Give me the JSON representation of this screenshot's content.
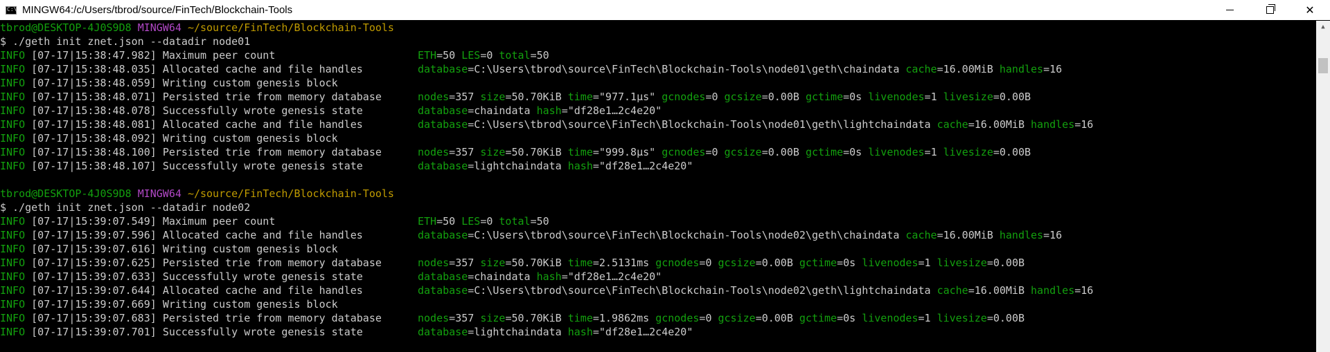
{
  "window": {
    "icon_text": "C:\\",
    "title": "MINGW64:/c/Users/tbrod/source/FinTech/Blockchain-Tools",
    "minimize_label": "",
    "maximize_label": "",
    "close_label": "✕"
  },
  "scrollbar": {
    "up_arrow": "▲"
  },
  "prompt": {
    "user_host": "tbrod@DESKTOP-4J0S9D8",
    "env": "MINGW64",
    "path": "~/source/FinTech/Blockchain-Tools"
  },
  "lines": [
    {
      "type": "prompt"
    },
    {
      "type": "cmd",
      "text": "$ ./geth init znet.json --datadir node01"
    },
    {
      "type": "log",
      "level": "INFO",
      "ts": "[07-17|15:38:47.982]",
      "msg": "Maximum peer count",
      "fields": [
        [
          "ETH",
          "50"
        ],
        [
          "LES",
          "0"
        ],
        [
          "total",
          "50"
        ]
      ]
    },
    {
      "type": "log",
      "level": "INFO",
      "ts": "[07-17|15:38:48.035]",
      "msg": "Allocated cache and file handles",
      "fields": [
        [
          "database",
          "C:\\Users\\tbrod\\source\\FinTech\\Blockchain-Tools\\node01\\geth\\chaindata"
        ],
        [
          "cache",
          "16.00MiB"
        ],
        [
          "handles",
          "16"
        ]
      ]
    },
    {
      "type": "log",
      "level": "INFO",
      "ts": "[07-17|15:38:48.059]",
      "msg": "Writing custom genesis block",
      "fields": []
    },
    {
      "type": "log",
      "level": "INFO",
      "ts": "[07-17|15:38:48.071]",
      "msg": "Persisted trie from memory database",
      "fields": [
        [
          "nodes",
          "357"
        ],
        [
          "size",
          "50.70KiB"
        ],
        [
          "time",
          "\"977.1µs\""
        ],
        [
          "gcnodes",
          "0"
        ],
        [
          "gcsize",
          "0.00B"
        ],
        [
          "gctime",
          "0s"
        ],
        [
          "livenodes",
          "1"
        ],
        [
          "livesize",
          "0.00B"
        ]
      ]
    },
    {
      "type": "log",
      "level": "INFO",
      "ts": "[07-17|15:38:48.078]",
      "msg": "Successfully wrote genesis state",
      "fields": [
        [
          "database",
          "chaindata"
        ],
        [
          "hash",
          "\"df28e1…2c4e20\""
        ]
      ]
    },
    {
      "type": "log",
      "level": "INFO",
      "ts": "[07-17|15:38:48.081]",
      "msg": "Allocated cache and file handles",
      "fields": [
        [
          "database",
          "C:\\Users\\tbrod\\source\\FinTech\\Blockchain-Tools\\node01\\geth\\lightchaindata"
        ],
        [
          "cache",
          "16.00MiB"
        ],
        [
          "handles",
          "16"
        ]
      ]
    },
    {
      "type": "log",
      "level": "INFO",
      "ts": "[07-17|15:38:48.092]",
      "msg": "Writing custom genesis block",
      "fields": []
    },
    {
      "type": "log",
      "level": "INFO",
      "ts": "[07-17|15:38:48.100]",
      "msg": "Persisted trie from memory database",
      "fields": [
        [
          "nodes",
          "357"
        ],
        [
          "size",
          "50.70KiB"
        ],
        [
          "time",
          "\"999.8µs\""
        ],
        [
          "gcnodes",
          "0"
        ],
        [
          "gcsize",
          "0.00B"
        ],
        [
          "gctime",
          "0s"
        ],
        [
          "livenodes",
          "1"
        ],
        [
          "livesize",
          "0.00B"
        ]
      ]
    },
    {
      "type": "log",
      "level": "INFO",
      "ts": "[07-17|15:38:48.107]",
      "msg": "Successfully wrote genesis state",
      "fields": [
        [
          "database",
          "lightchaindata"
        ],
        [
          "hash",
          "\"df28e1…2c4e20\""
        ]
      ]
    },
    {
      "type": "blank"
    },
    {
      "type": "prompt"
    },
    {
      "type": "cmd",
      "text": "$ ./geth init znet.json --datadir node02"
    },
    {
      "type": "log",
      "level": "INFO",
      "ts": "[07-17|15:39:07.549]",
      "msg": "Maximum peer count",
      "fields": [
        [
          "ETH",
          "50"
        ],
        [
          "LES",
          "0"
        ],
        [
          "total",
          "50"
        ]
      ]
    },
    {
      "type": "log",
      "level": "INFO",
      "ts": "[07-17|15:39:07.596]",
      "msg": "Allocated cache and file handles",
      "fields": [
        [
          "database",
          "C:\\Users\\tbrod\\source\\FinTech\\Blockchain-Tools\\node02\\geth\\chaindata"
        ],
        [
          "cache",
          "16.00MiB"
        ],
        [
          "handles",
          "16"
        ]
      ]
    },
    {
      "type": "log",
      "level": "INFO",
      "ts": "[07-17|15:39:07.616]",
      "msg": "Writing custom genesis block",
      "fields": []
    },
    {
      "type": "log",
      "level": "INFO",
      "ts": "[07-17|15:39:07.625]",
      "msg": "Persisted trie from memory database",
      "fields": [
        [
          "nodes",
          "357"
        ],
        [
          "size",
          "50.70KiB"
        ],
        [
          "time",
          "2.5131ms"
        ],
        [
          "gcnodes",
          "0"
        ],
        [
          "gcsize",
          "0.00B"
        ],
        [
          "gctime",
          "0s"
        ],
        [
          "livenodes",
          "1"
        ],
        [
          "livesize",
          "0.00B"
        ]
      ]
    },
    {
      "type": "log",
      "level": "INFO",
      "ts": "[07-17|15:39:07.633]",
      "msg": "Successfully wrote genesis state",
      "fields": [
        [
          "database",
          "chaindata"
        ],
        [
          "hash",
          "\"df28e1…2c4e20\""
        ]
      ]
    },
    {
      "type": "log",
      "level": "INFO",
      "ts": "[07-17|15:39:07.644]",
      "msg": "Allocated cache and file handles",
      "fields": [
        [
          "database",
          "C:\\Users\\tbrod\\source\\FinTech\\Blockchain-Tools\\node02\\geth\\lightchaindata"
        ],
        [
          "cache",
          "16.00MiB"
        ],
        [
          "handles",
          "16"
        ]
      ]
    },
    {
      "type": "log",
      "level": "INFO",
      "ts": "[07-17|15:39:07.669]",
      "msg": "Writing custom genesis block",
      "fields": []
    },
    {
      "type": "log",
      "level": "INFO",
      "ts": "[07-17|15:39:07.683]",
      "msg": "Persisted trie from memory database",
      "fields": [
        [
          "nodes",
          "357"
        ],
        [
          "size",
          "50.70KiB"
        ],
        [
          "time",
          "1.9862ms"
        ],
        [
          "gcnodes",
          "0"
        ],
        [
          "gcsize",
          "0.00B"
        ],
        [
          "gctime",
          "0s"
        ],
        [
          "livenodes",
          "1"
        ],
        [
          "livesize",
          "0.00B"
        ]
      ]
    },
    {
      "type": "log",
      "level": "INFO",
      "ts": "[07-17|15:39:07.701]",
      "msg": "Successfully wrote genesis state",
      "fields": [
        [
          "database",
          "lightchaindata"
        ],
        [
          "hash",
          "\"df28e1…2c4e20\""
        ]
      ]
    }
  ],
  "colors": {
    "background": "#000000",
    "text": "#c0c0c0",
    "info_green": "#13a10e",
    "prompt_purple": "#b148c6",
    "path_yellow": "#c19c00"
  }
}
